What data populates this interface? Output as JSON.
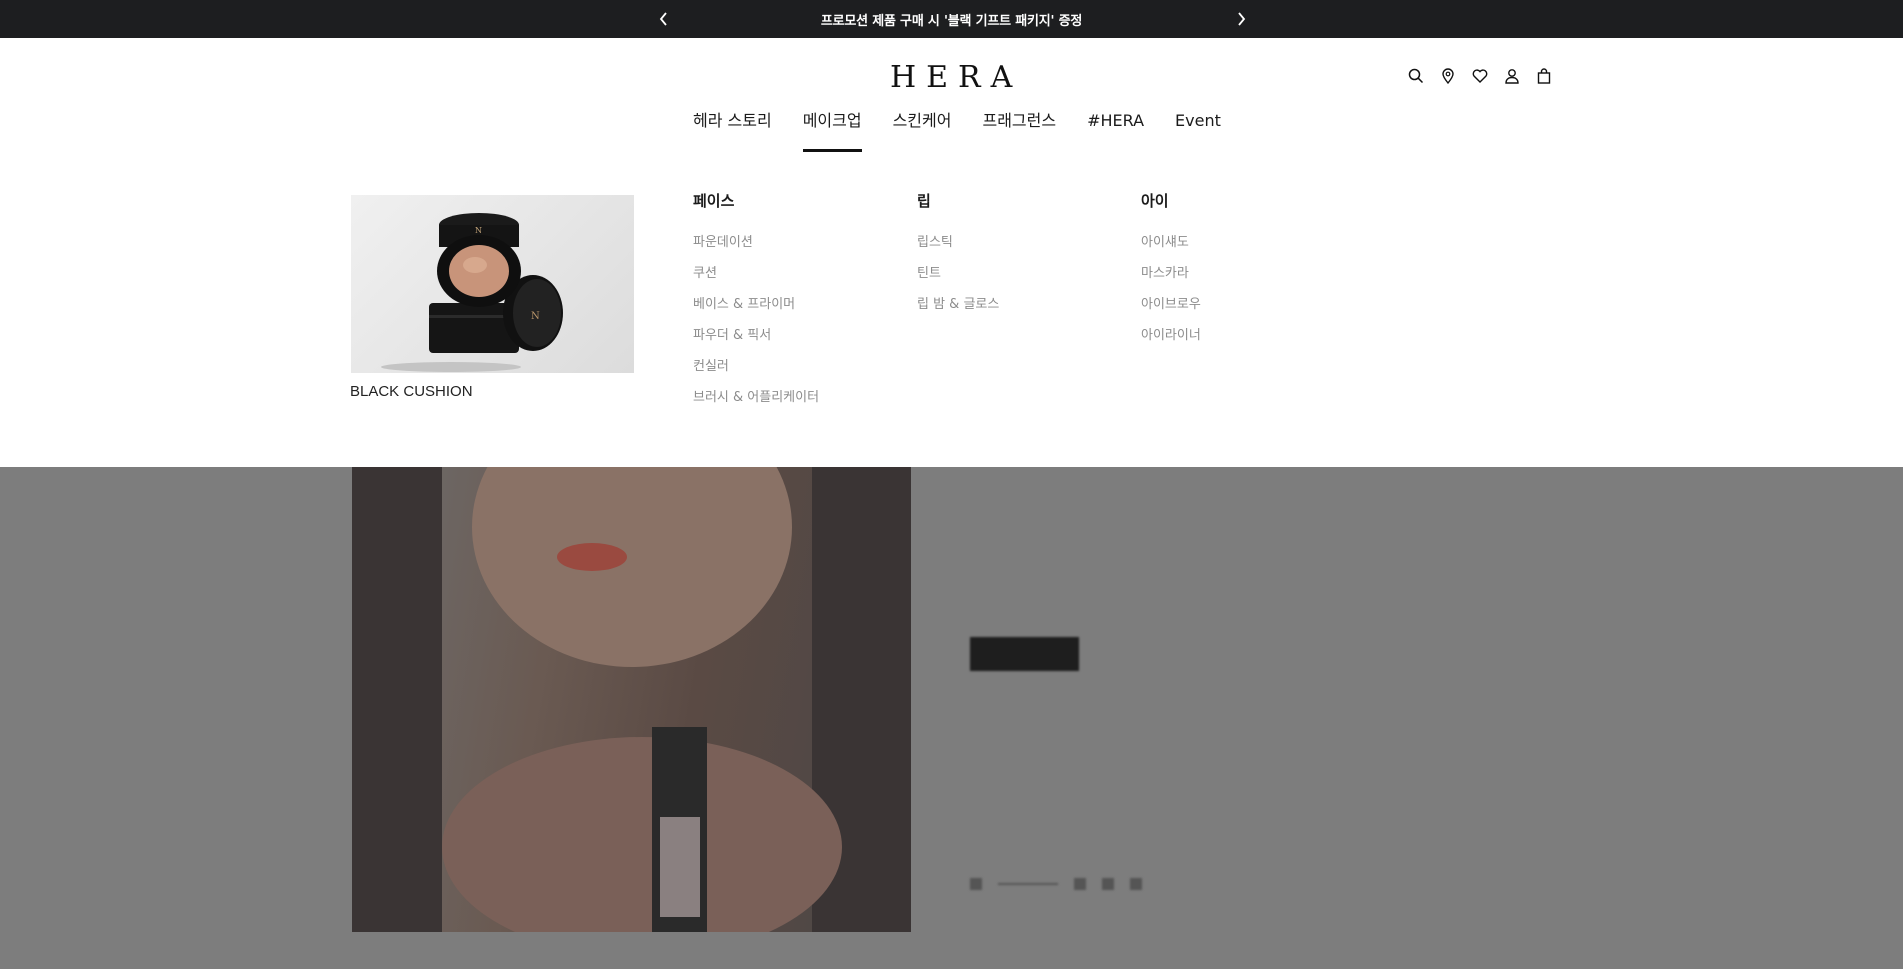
{
  "promo_bar": {
    "message": "프로모션 제품 구매 시 '블랙 기프트 패키지' 증정",
    "prev_icon": "chevron-left-icon",
    "next_icon": "chevron-right-icon"
  },
  "header": {
    "logo": "HERA",
    "utilities": [
      "search-icon",
      "location-pin-icon",
      "heart-icon",
      "user-icon",
      "shopping-bag-icon"
    ]
  },
  "gnb": {
    "items": [
      {
        "label": "헤라 스토리"
      },
      {
        "label": "메이크업",
        "active": true
      },
      {
        "label": "스킨케어"
      },
      {
        "label": "프래그런스"
      },
      {
        "label": "#HERA"
      },
      {
        "label": "Event"
      }
    ]
  },
  "mega_menu": {
    "promo_label": "BLACK CUSHION",
    "columns": [
      {
        "title": "페이스",
        "items": [
          "파운데이션",
          "쿠션",
          "베이스 & 프라이머",
          "파우더 & 픽서",
          "컨실러",
          "브러시 & 어플리케이터"
        ]
      },
      {
        "title": "립",
        "items": [
          "립스틱",
          "틴트",
          "립 밤 & 글로스"
        ]
      },
      {
        "title": "아이",
        "items": [
          "아이섀도",
          "마스카라",
          "아이브로우",
          "아이라이너"
        ]
      }
    ]
  },
  "colors": {
    "promo_bar_bg": "#1d1e20",
    "overlay_bg": "#7d7d7d",
    "active_underline": "#111111",
    "submenu_text": "#8c8c8c"
  }
}
